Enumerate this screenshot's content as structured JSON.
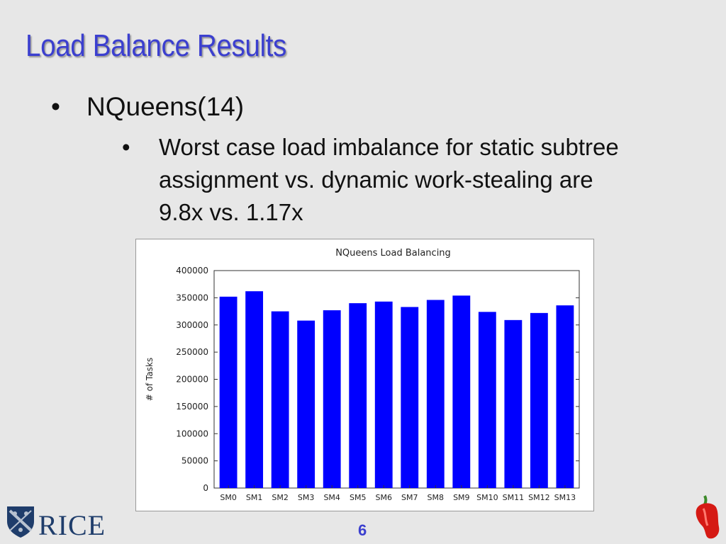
{
  "slide": {
    "title": "Load Balance Results",
    "bullet1": "NQueens(14)",
    "bullet1_marker": "•",
    "bullet2": "Worst case load imbalance for static subtree assignment vs. dynamic work-stealing are 9.8x vs. 1.17x",
    "bullet2_marker": "•",
    "page_number": "6"
  },
  "footer": {
    "logo_text": "RICE",
    "logo_icon": "rice-shield-icon",
    "mascot_icon": "chili-pepper-icon"
  },
  "colors": {
    "title": "#3b3fcf",
    "bar": "#0000ff",
    "background": "#e7e7e7"
  },
  "chart_data": {
    "type": "bar",
    "title": "NQueens Load Balancing",
    "xlabel": "",
    "ylabel": "# of Tasks",
    "categories": [
      "SM0",
      "SM1",
      "SM2",
      "SM3",
      "SM4",
      "SM5",
      "SM6",
      "SM7",
      "SM8",
      "SM9",
      "SM10",
      "SM11",
      "SM12",
      "SM13"
    ],
    "values": [
      352000,
      362000,
      325000,
      308000,
      327000,
      340000,
      343000,
      333000,
      346000,
      354000,
      324000,
      309000,
      322000,
      336000
    ],
    "ylim": [
      0,
      400000
    ],
    "yticks": [
      "0",
      "50000",
      "100000",
      "150000",
      "200000",
      "250000",
      "300000",
      "350000",
      "400000"
    ],
    "grid": false,
    "legend": "none"
  }
}
